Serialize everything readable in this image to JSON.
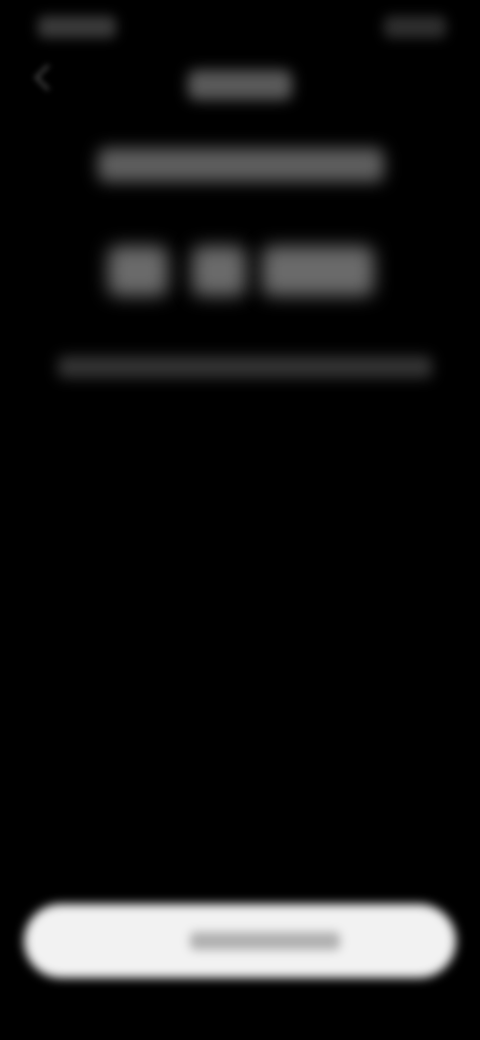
{
  "theme": {
    "background": "#000000",
    "text": "#ffffff",
    "button_background": "#f2f2f2"
  },
  "status_bar": {
    "time": "",
    "icons": ""
  },
  "header": {
    "back_icon": "chevron-left-icon",
    "title": ""
  },
  "content": {
    "subtitle": "",
    "value_parts": [
      "",
      "",
      ""
    ],
    "info": ""
  },
  "footer": {
    "primary_button_label": ""
  }
}
